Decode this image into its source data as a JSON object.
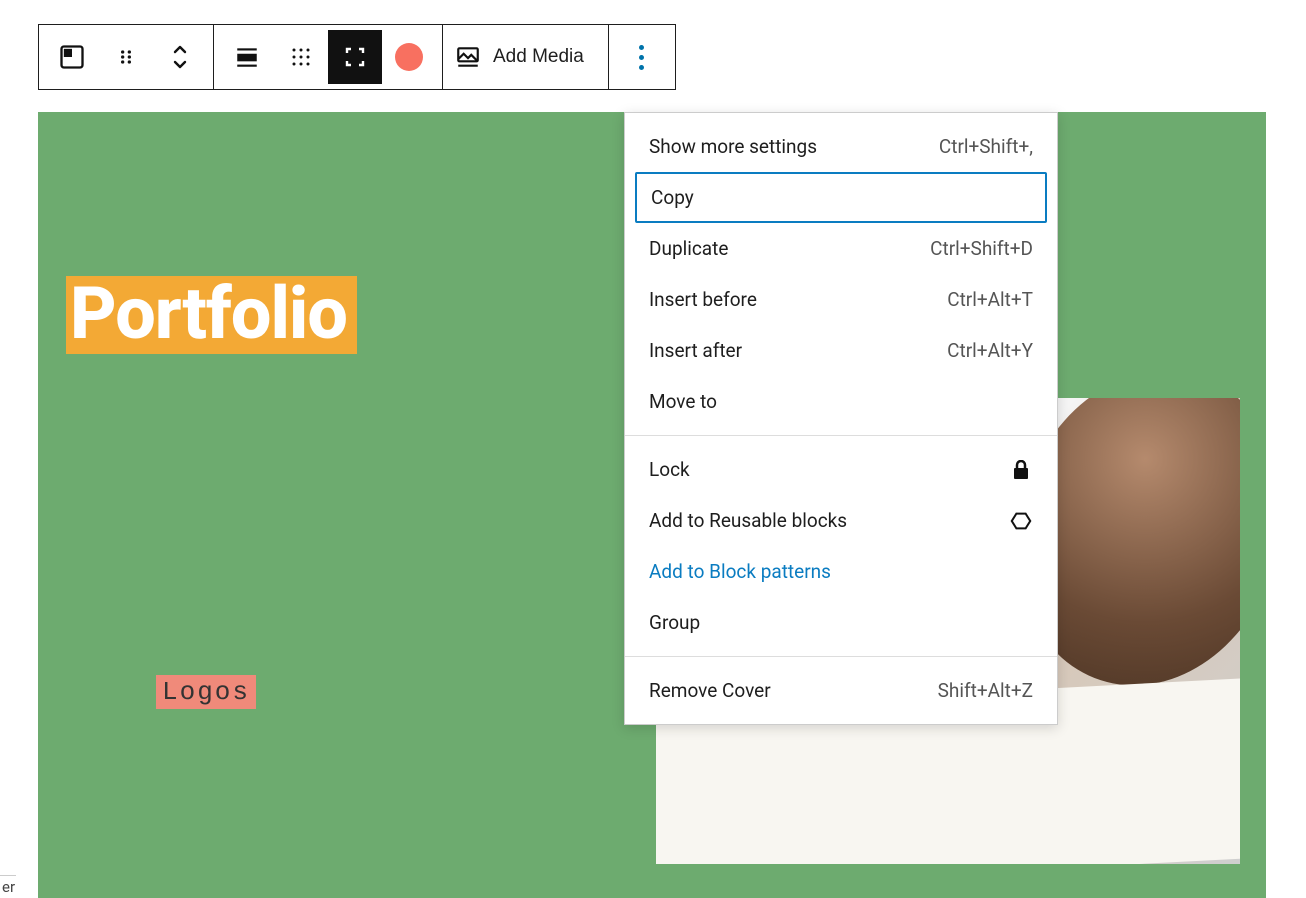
{
  "toolbar": {
    "add_media_label": "Add Media"
  },
  "canvas": {
    "title": "Portfolio",
    "sublabel": "Logos"
  },
  "menu": {
    "section1": [
      {
        "label": "Show more settings",
        "shortcut": "Ctrl+Shift+,"
      },
      {
        "label": "Copy",
        "shortcut": "",
        "focused": true
      },
      {
        "label": "Duplicate",
        "shortcut": "Ctrl+Shift+D"
      },
      {
        "label": "Insert before",
        "shortcut": "Ctrl+Alt+T"
      },
      {
        "label": "Insert after",
        "shortcut": "Ctrl+Alt+Y"
      },
      {
        "label": "Move to",
        "shortcut": ""
      }
    ],
    "section2": [
      {
        "label": "Lock",
        "icon": "lock"
      },
      {
        "label": "Add to Reusable blocks",
        "icon": "reusable"
      },
      {
        "label": "Add to Block patterns",
        "link": true
      },
      {
        "label": "Group"
      }
    ],
    "section3": [
      {
        "label": "Remove Cover",
        "shortcut": "Shift+Alt+Z"
      }
    ]
  },
  "footer": {
    "text": "er"
  },
  "colors": {
    "canvas_bg": "#6dab6f",
    "title_bg": "#f3a935",
    "logos_bg": "#f08a7a",
    "swatch": "#f87060",
    "link": "#0a7cc1"
  }
}
